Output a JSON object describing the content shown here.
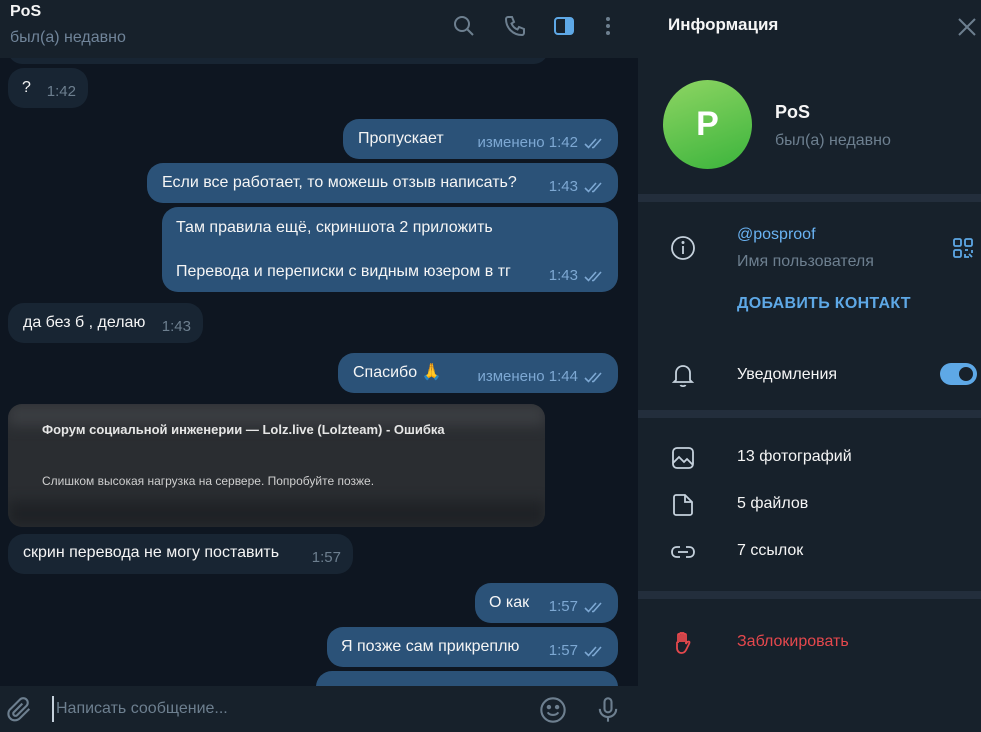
{
  "chat": {
    "title": "PoS",
    "status": "был(а) недавно",
    "composer_placeholder": "Написать сообщение...",
    "messages": [
      {
        "dir": "in",
        "text": "?",
        "time": "1:42"
      },
      {
        "dir": "out",
        "text": "Пропускает",
        "time": "изменено 1:42"
      },
      {
        "dir": "out",
        "text": "Если все работает, то можешь отзыв написать?",
        "time": "1:43"
      },
      {
        "dir": "out",
        "text_line1": "Там правила ещё, скриншота 2 приложить",
        "text_line2": "Перевода и переписки с видным юзером в тг",
        "time": "1:43"
      },
      {
        "dir": "in",
        "text": "да без б , делаю",
        "time": "1:43"
      },
      {
        "dir": "out",
        "text": "Спасибо 🙏",
        "time": "изменено 1:44"
      },
      {
        "dir": "in",
        "text": "скрин перевода не могу поставить",
        "time": "1:57"
      },
      {
        "dir": "out",
        "text": "О как",
        "time": "1:57"
      },
      {
        "dir": "out",
        "text": "Я позже сам прикреплю",
        "time": "1:57"
      }
    ],
    "screenshot_preview": {
      "title": "Форум социальной инженерии — Lolz.live (Lolzteam) - Ошибка",
      "text": "Слишком высокая нагрузка на сервере. Попробуйте позже."
    }
  },
  "info": {
    "title": "Информация",
    "avatar_letter": "P",
    "name": "PoS",
    "status": "был(а) недавно",
    "username": "@posproof",
    "username_caption": "Имя пользователя",
    "add_contact": "ДОБАВИТЬ КОНТАКТ",
    "notifications": "Уведомления",
    "notifications_on": true,
    "photos": "13 фотографий",
    "files": "5 файлов",
    "links": "7 ссылок",
    "block": "Заблокировать"
  },
  "colors": {
    "accent": "#5ea8e6",
    "outgoing_bubble": "#2b5278",
    "incoming_bubble": "#182533",
    "danger": "#e5484d",
    "avatar_green": "#3bb43c"
  }
}
